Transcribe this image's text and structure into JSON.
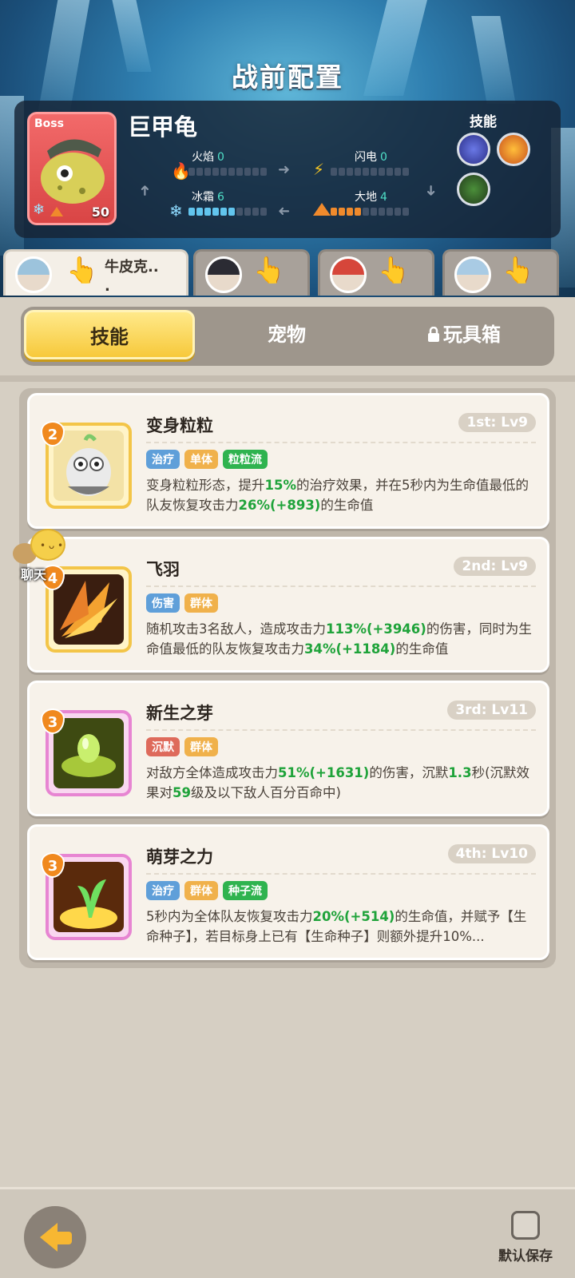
{
  "page_title": "战前配置",
  "boss": {
    "tag": "Boss",
    "level": "50",
    "name": "巨甲龟",
    "elements": [
      {
        "name": "火焰",
        "value": "0",
        "icon": "fire-icon",
        "filled": 0,
        "kind": "fire"
      },
      {
        "name": "闪电",
        "value": "0",
        "icon": "lightning-icon",
        "filled": 0,
        "kind": "thunder"
      },
      {
        "name": "冰霜",
        "value": "6",
        "icon": "snowflake-icon",
        "filled": 6,
        "kind": "ice"
      },
      {
        "name": "大地",
        "value": "4",
        "icon": "mountain-icon",
        "filled": 4,
        "kind": "earth"
      }
    ],
    "skills_label": "技能"
  },
  "heroes": [
    {
      "name": "牛皮克..\n.",
      "active": true
    },
    {
      "name": "",
      "active": false
    },
    {
      "name": "",
      "active": false
    },
    {
      "name": "",
      "active": false
    }
  ],
  "tabs": {
    "skills": "技能",
    "pets": "宠物",
    "toybox": "玩具箱"
  },
  "skills": [
    {
      "title": "变身粒粒",
      "level": "1st: Lv9",
      "badge": "2",
      "tags": [
        [
          "治疗",
          "blue"
        ],
        [
          "单体",
          "orange"
        ],
        [
          "粒粒流",
          "green"
        ]
      ],
      "desc": [
        "变身粒粒形态，提升",
        "15%",
        "的治疗效果，并在5秒内为生命值最低的队友恢复攻击力",
        "26%(+893)",
        "的生命值"
      ]
    },
    {
      "title": "飞羽",
      "level": "2nd: Lv9",
      "badge": "4",
      "tags": [
        [
          "伤害",
          "blue"
        ],
        [
          "群体",
          "orange"
        ]
      ],
      "desc": [
        "随机攻击3名敌人，造成攻击力",
        "113%(+3946)",
        "的伤害，同时为生命值最低的队友恢复攻击力",
        "34%(+1184)",
        "的生命值"
      ]
    },
    {
      "title": "新生之芽",
      "level": "3rd: Lv11",
      "badge": "3",
      "tags": [
        [
          "沉默",
          "red"
        ],
        [
          "群体",
          "orange"
        ]
      ],
      "desc": [
        "对敌方全体造成攻击力",
        "51%(+1631)",
        "的伤害，沉默",
        "1.3",
        "秒(沉默效果对",
        "59",
        "级及以下敌人百分百命中)"
      ]
    },
    {
      "title": "萌芽之力",
      "level": "4th: Lv10",
      "badge": "3",
      "tags": [
        [
          "治疗",
          "blue"
        ],
        [
          "群体",
          "orange"
        ],
        [
          "种子流",
          "green"
        ]
      ],
      "desc": [
        "5秒内为全体队友恢复攻击力",
        "20%(+514)",
        "的生命值，并赋予【生命种子】，若目标身上已有【生命种子】则额外提升10%..."
      ]
    }
  ],
  "chat_label": "聊天",
  "save_label": "默认保存"
}
